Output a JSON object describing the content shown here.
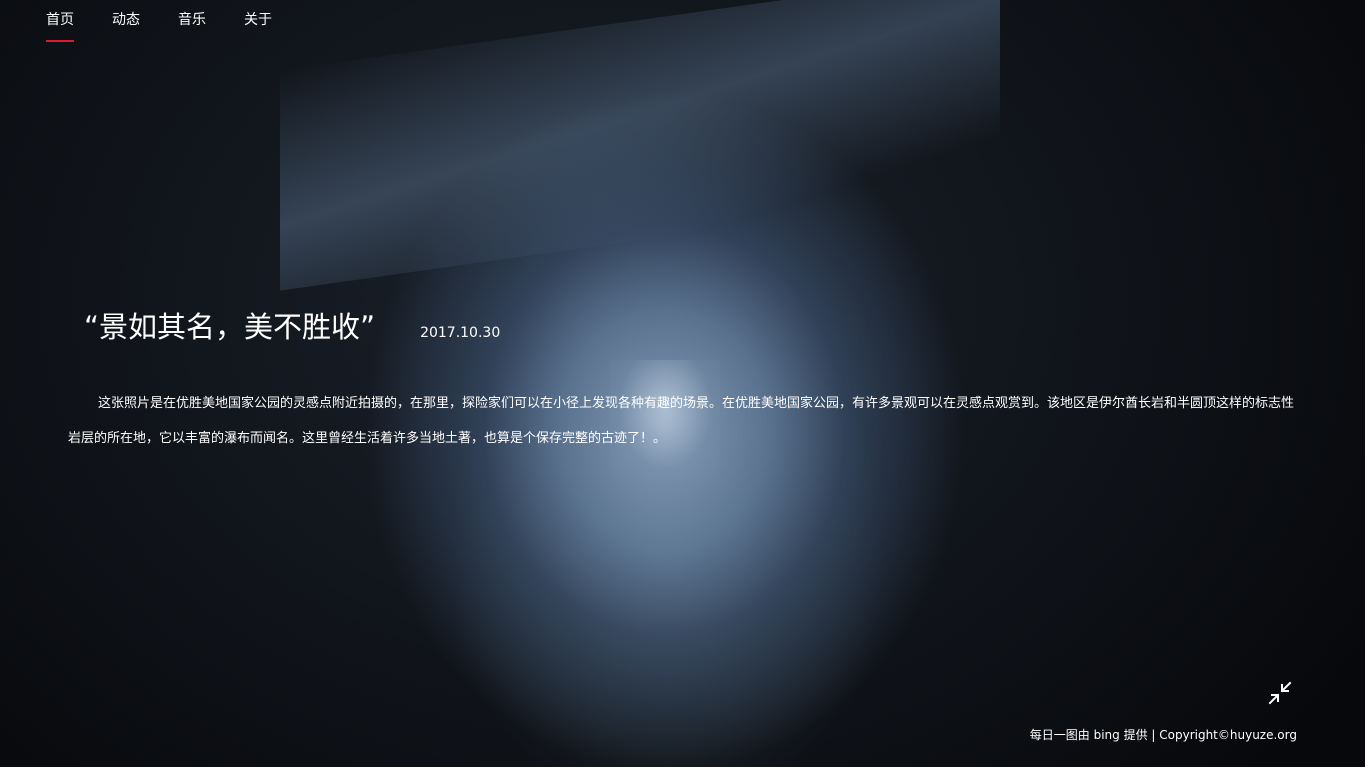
{
  "nav": {
    "items": [
      {
        "label": "首页",
        "active": true
      },
      {
        "label": "动态",
        "active": false
      },
      {
        "label": "音乐",
        "active": false
      },
      {
        "label": "关于",
        "active": false
      }
    ],
    "active_color": "#e0182b"
  },
  "story": {
    "title": "“景如其名，美不胜收”",
    "date": "2017.10.30",
    "description": "这张照片是在优胜美地国家公园的灵感点附近拍摄的，在那里，探险家们可以在小径上发现各种有趣的场景。在优胜美地国家公园，有许多景观可以在灵感点观赏到。该地区是伊尔酋长岩和半圆顶这样的标志性岩层的所在地，它以丰富的瀑布而闻名。这里曾经生活着许多当地土著，也算是个保存完整的古迹了！。"
  },
  "controls": {
    "shrink_icon": "collapse-arrows-icon"
  },
  "footer": {
    "text": "每日一图由 bing 提供 | Copyright©huyuze.org"
  }
}
